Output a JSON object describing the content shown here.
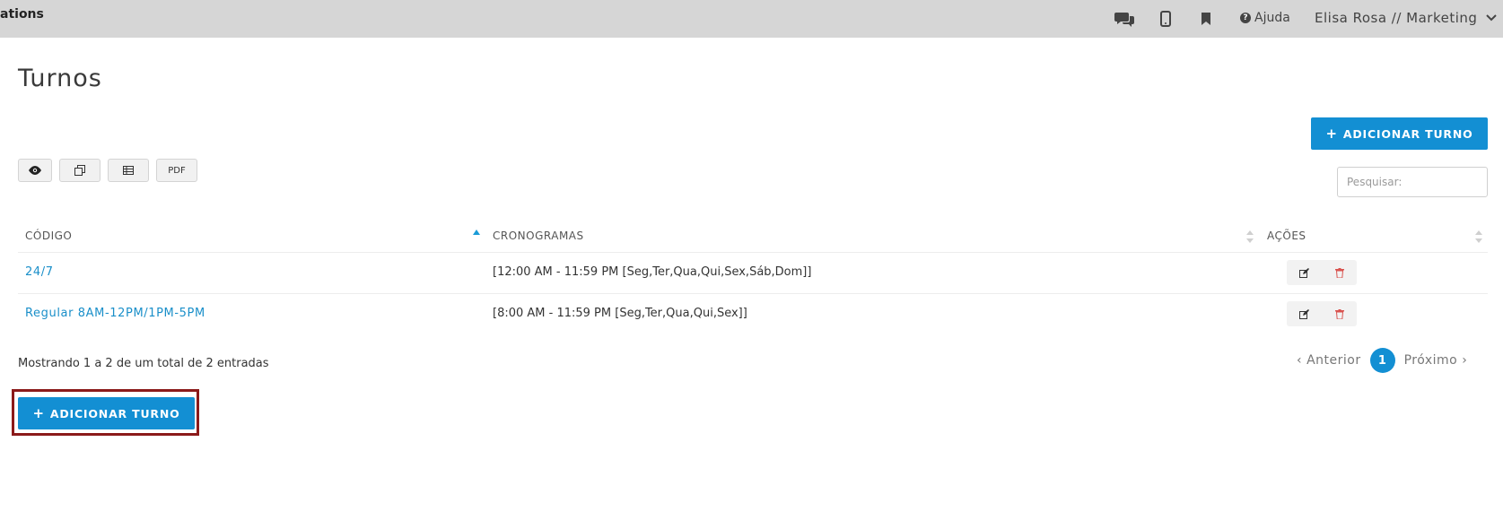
{
  "header": {
    "brand": "ations",
    "help_label": "Ajuda",
    "user_label": "Elisa Rosa // Marketing"
  },
  "page": {
    "title": "Turnos",
    "add_button_label": "ADICIONAR TURNO"
  },
  "toolbar": {
    "pdf_label": "PDF"
  },
  "search": {
    "placeholder": "Pesquisar:"
  },
  "table": {
    "columns": [
      "CÓDIGO",
      "CRONOGRAMAS",
      "AÇÕES"
    ],
    "rows": [
      {
        "code": "24/7",
        "schedule": "[12:00 AM - 11:59 PM [Seg,Ter,Qua,Qui,Sex,Sáb,Dom]]"
      },
      {
        "code": "Regular 8AM-12PM/1PM-5PM",
        "schedule": "[8:00 AM - 11:59 PM [Seg,Ter,Qua,Qui,Sex]]"
      }
    ]
  },
  "footer": {
    "info": "Mostrando 1 a 2 de um total de 2 entradas",
    "prev_label": "Anterior",
    "next_label": "Próximo",
    "current_page": "1"
  },
  "colors": {
    "accent": "#138fd3",
    "link": "#1a8fc9",
    "delete": "#d9534f",
    "highlight_border": "#8b1a1a"
  }
}
